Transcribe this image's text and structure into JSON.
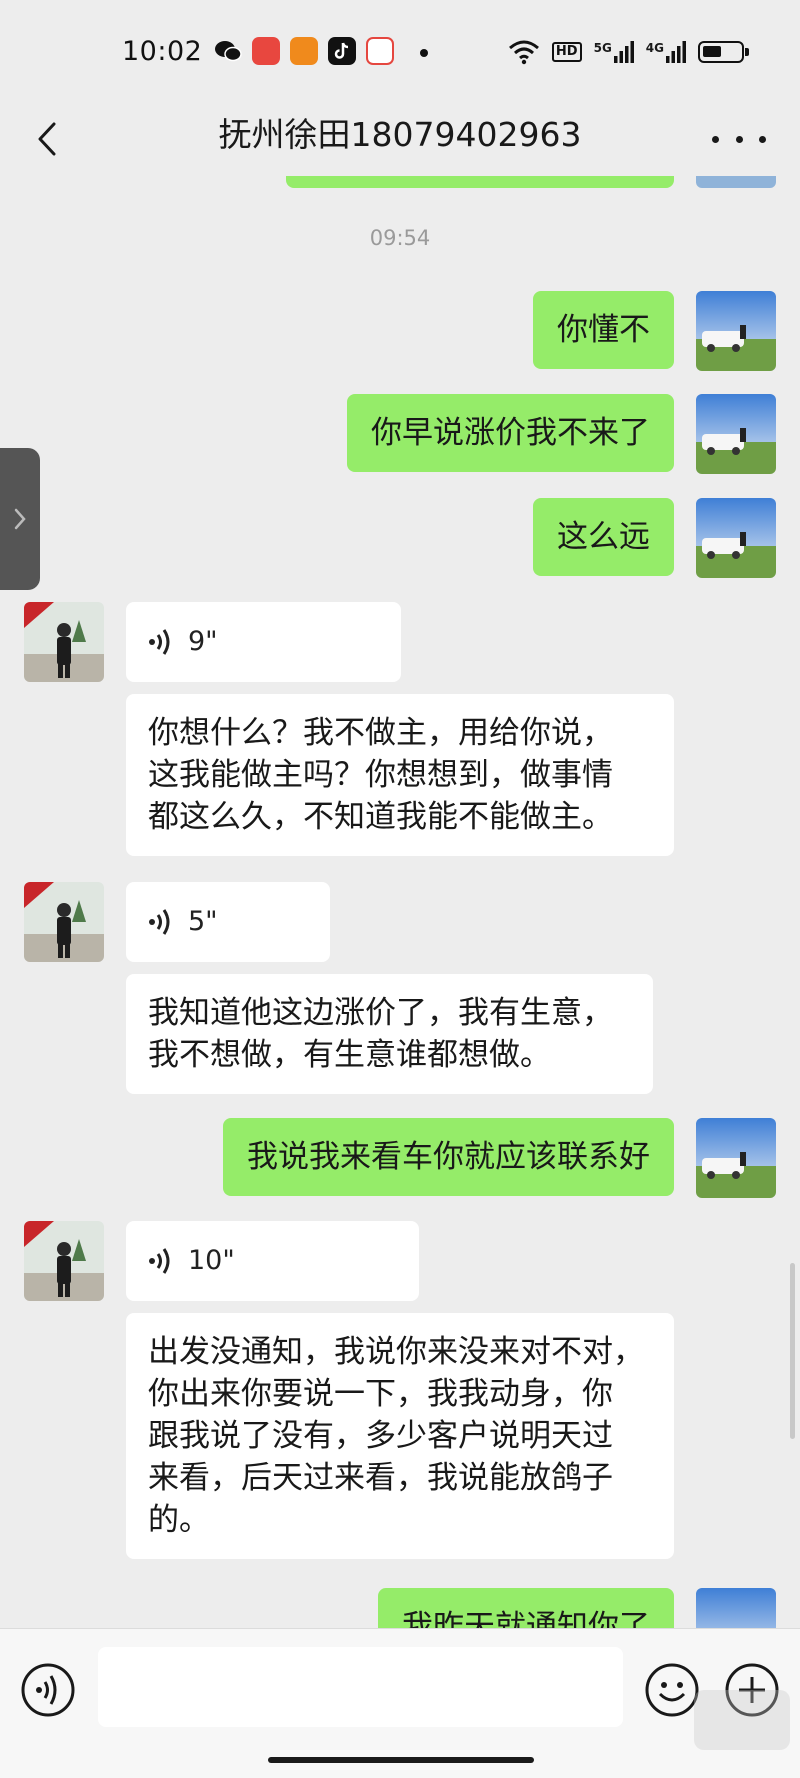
{
  "status_bar": {
    "time": "10:02",
    "app_icons": [
      "wechat-icon",
      "app-icon-1",
      "app-icon-2",
      "tiktok-icon",
      "app-icon-3"
    ],
    "right_icons": [
      "wifi-icon",
      "hd-icon",
      "signal-5g-icon",
      "signal-4g-icon",
      "battery-icon"
    ],
    "hd_label": "HD",
    "net_5g": "5G",
    "net_4g": "4G"
  },
  "header": {
    "title": "抚州徐田18079402963"
  },
  "chat": {
    "timestamp": "09:54",
    "messages": [
      {
        "from": "me",
        "text": "你懂不"
      },
      {
        "from": "me",
        "text": "你早说涨价我不来了"
      },
      {
        "from": "me",
        "text": "这么远"
      },
      {
        "from": "other",
        "voice": "9\"",
        "transcript": [
          "你想什么？我不做主，用给你说，",
          "这我能做主吗？你想想到，做事情",
          "都这么久，不知道我能不能做主。"
        ]
      },
      {
        "from": "other",
        "voice": "5\"",
        "transcript": [
          "我知道他这边涨价了，我有生意，",
          "我不想做，有生意谁都想做。"
        ]
      },
      {
        "from": "me",
        "text": "我说我来看车你就应该联系好"
      },
      {
        "from": "other",
        "voice": "10\"",
        "transcript": [
          "出发没通知，我说你来没来对不对，",
          "你出来你要说一下，我我动身，你",
          "跟我说了没有，多少客户说明天过",
          "来看，后天过来看，我说能放鸽子",
          "的。"
        ]
      },
      {
        "from": "me",
        "text": "我昨天就通知你了"
      }
    ]
  },
  "input_bar": {
    "placeholder": ""
  },
  "colors": {
    "background": "#ededed",
    "my_bubble": "#95ec69",
    "other_bubble": "#ffffff"
  }
}
